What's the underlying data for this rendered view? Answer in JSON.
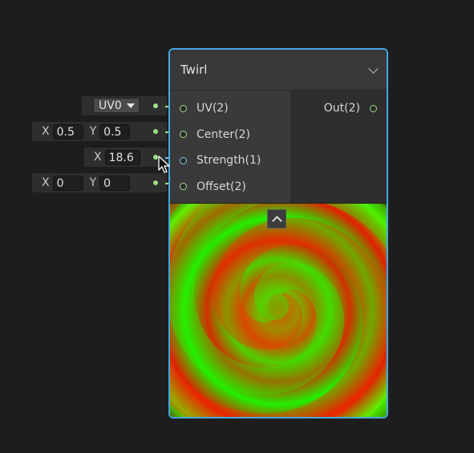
{
  "node": {
    "title": "Twirl",
    "inputs": [
      {
        "label": "UV(2)"
      },
      {
        "label": "Center(2)"
      },
      {
        "label": "Strength(1)"
      },
      {
        "label": "Offset(2)"
      }
    ],
    "outputs": [
      {
        "label": "Out(2)"
      }
    ]
  },
  "fields": {
    "uv": {
      "selected": "UV0"
    },
    "center": {
      "x_label": "X",
      "x_value": "0.5",
      "y_label": "Y",
      "y_value": "0.5"
    },
    "strength": {
      "x_label": "X",
      "x_value": "18.6"
    },
    "offset": {
      "x_label": "X",
      "x_value": "0",
      "y_label": "Y",
      "y_value": "0"
    }
  },
  "colors": {
    "node_border": "#44a8e0",
    "vector_port": "#9ee089",
    "float_port": "#8cc9e8",
    "canvas": "#1d1d1d"
  },
  "icons": {
    "collapse": "chevron-down-icon",
    "preview_toggle": "chevron-up-icon",
    "dropdown": "caret-down-icon",
    "cursor": "mouse-pointer-icon"
  }
}
